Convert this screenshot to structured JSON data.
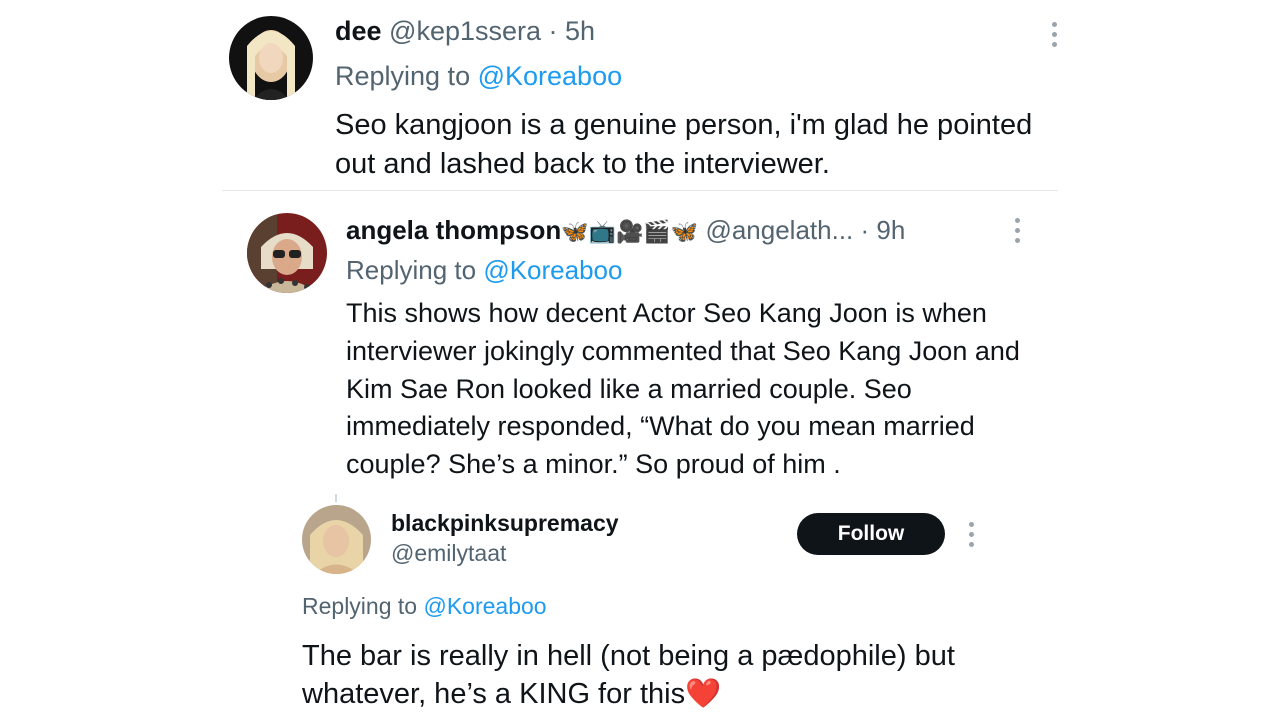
{
  "tweets": [
    {
      "display_name": "dee",
      "handle": "@kep1ssera",
      "time": "· 5h",
      "replying_prefix": "Replying to ",
      "replying_to": "@Koreaboo",
      "text": "Seo kangjoon is a genuine person, i'm glad he pointed out and lashed back to the interviewer.",
      "avatar_icon": "avatar-photo"
    },
    {
      "display_name": "angela thompson",
      "name_emojis": "🦋📺🎥🎬🦋",
      "handle": "@angelath...",
      "time": "· 9h",
      "replying_prefix": "Replying to ",
      "replying_to": "@Koreaboo",
      "text": "This shows how decent Actor Seo Kang Joon is when interviewer jokingly commented that Seo Kang Joon and Kim Sae Ron looked like a married couple. Seo immediately responded, “What do you mean married couple? She’s a minor.” So proud of him .",
      "avatar_icon": "avatar-photo"
    },
    {
      "display_name": "blackpinksupremacy",
      "handle": "@emilytaat",
      "follow_label": "Follow",
      "replying_prefix": "Replying to ",
      "replying_to": "@Koreaboo",
      "text": "The bar is really in hell (not being a pædophile) but whatever, he’s a KING for this",
      "text_emoji": "❤️",
      "avatar_icon": "avatar-photo"
    }
  ],
  "colors": {
    "text": "#0f1419",
    "muted": "#536471",
    "link": "#1d9bf0",
    "follow_bg": "#0f1419",
    "divider": "#e6e9eb"
  },
  "icons": [
    "more-options-icon"
  ]
}
